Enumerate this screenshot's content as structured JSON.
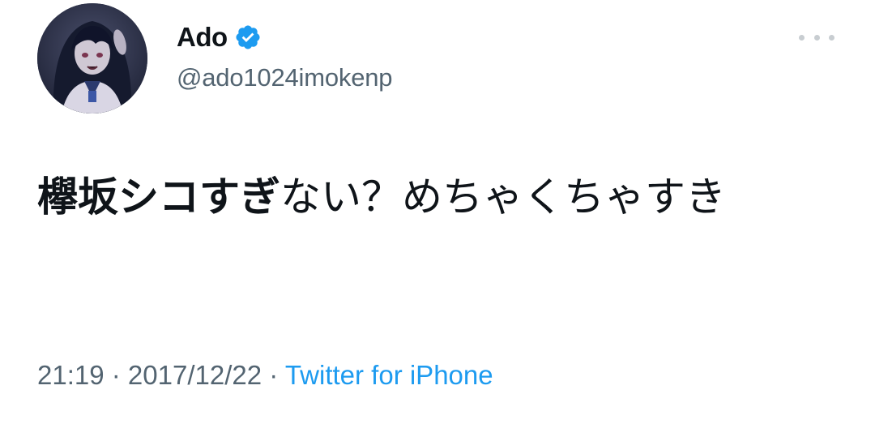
{
  "user": {
    "display_name": "Ado",
    "handle": "@ado1024imokenp",
    "verified_icon": "verified-badge-icon",
    "avatar": "user-avatar-illustration"
  },
  "menu": {
    "icon": "more-options-icon"
  },
  "tweet": {
    "text_bold": "欅坂シコすぎ",
    "text_regular": "ない？めちゃくちゃすき"
  },
  "meta": {
    "time": "21:19",
    "separator1": " · ",
    "date": "2017/12/22",
    "separator2": " · ",
    "source": "Twitter for iPhone"
  },
  "colors": {
    "text_primary": "#0f1419",
    "text_secondary": "#536471",
    "accent": "#1d9bf0",
    "background": "#ffffff"
  }
}
